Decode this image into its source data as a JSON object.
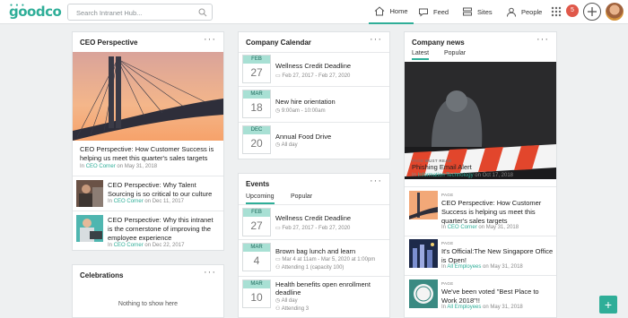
{
  "topbar": {
    "logo": "goodco",
    "search_placeholder": "Search Intranet Hub...",
    "nav": [
      {
        "label": "Home",
        "icon": "home-icon"
      },
      {
        "label": "Feed",
        "icon": "chat-bubble-icon"
      },
      {
        "label": "Sites",
        "icon": "sites-icon"
      },
      {
        "label": "People",
        "icon": "person-icon"
      }
    ],
    "notifications_count": "5",
    "accent": "#2fae98"
  },
  "ceo": {
    "header": "CEO Perspective",
    "featured": {
      "title": "CEO Perspective: How Customer Success is helping us meet this quarter's sales targets",
      "meta_prefix": "In",
      "category": "CEO Corner",
      "date": "on May 31, 2018"
    },
    "items": [
      {
        "title": "CEO Perspective: Why Talent Sourcing is so critical to our culture",
        "meta_prefix": "In",
        "category": "CEO Corner",
        "date": "on Dec 11, 2017"
      },
      {
        "title": "CEO Perspective: Why this intranet is the cornerstone of improving the employee experience",
        "meta_prefix": "In",
        "category": "CEO Corner",
        "date": "on Dec 22, 2017"
      }
    ]
  },
  "celebrations": {
    "header": "Celebrations",
    "empty": "Nothing to show here"
  },
  "calendar": {
    "header": "Company Calendar",
    "events": [
      {
        "month": "FEB",
        "day": "27",
        "title": "Wellness Credit Deadline",
        "meta": "Feb 27, 2017 - Feb 27, 2020"
      },
      {
        "month": "MAR",
        "day": "18",
        "title": "New hire orientation",
        "meta": "9:00am - 10:00am"
      },
      {
        "month": "DEC",
        "day": "20",
        "title": "Annual Food Drive",
        "meta": "All day"
      }
    ]
  },
  "events": {
    "header": "Events",
    "tabs": [
      "Upcoming",
      "Popular"
    ],
    "items": [
      {
        "month": "FEB",
        "day": "27",
        "title": "Wellness Credit Deadline",
        "meta": "Feb 27, 2017 - Feb 27, 2020"
      },
      {
        "month": "MAR",
        "day": "4",
        "title": "Brown bag lunch and learn",
        "meta": "Mar 4 at 11am - Mar 5, 2020 at 1:00pm",
        "meta2": "Attending 1 (capacity 100)"
      },
      {
        "month": "MAR",
        "day": "10",
        "title": "Health benefits open enrollment deadline",
        "meta": "All day",
        "meta2": "Attending 3"
      }
    ]
  },
  "news": {
    "header": "Company news",
    "tabs": [
      "Latest",
      "Popular"
    ],
    "featured": {
      "kicker_a": "PAGE",
      "kicker_b": "MUST READ",
      "title": "Phishing Email Alert",
      "meta_prefix": "In",
      "category": "Information Technology",
      "date": "on Oct 17, 2018"
    },
    "items": [
      {
        "kicker": "PAGE",
        "title": "CEO Perspective: How Customer Success is helping us meet this quarter's sales targets",
        "meta_prefix": "In",
        "category": "CEO Corner",
        "date": "on May 31, 2018"
      },
      {
        "kicker": "PAGE",
        "title": "It's Official:The New Singapore Office is Open!",
        "meta_prefix": "In",
        "category": "All Employees",
        "date": "on May 31, 2018"
      },
      {
        "kicker": "PAGE",
        "title": "We've been voted \"Best Place to Work 2018\"!!",
        "meta_prefix": "In",
        "category": "All Employees",
        "date": "on May 31, 2018"
      }
    ]
  },
  "fab_label": "+"
}
